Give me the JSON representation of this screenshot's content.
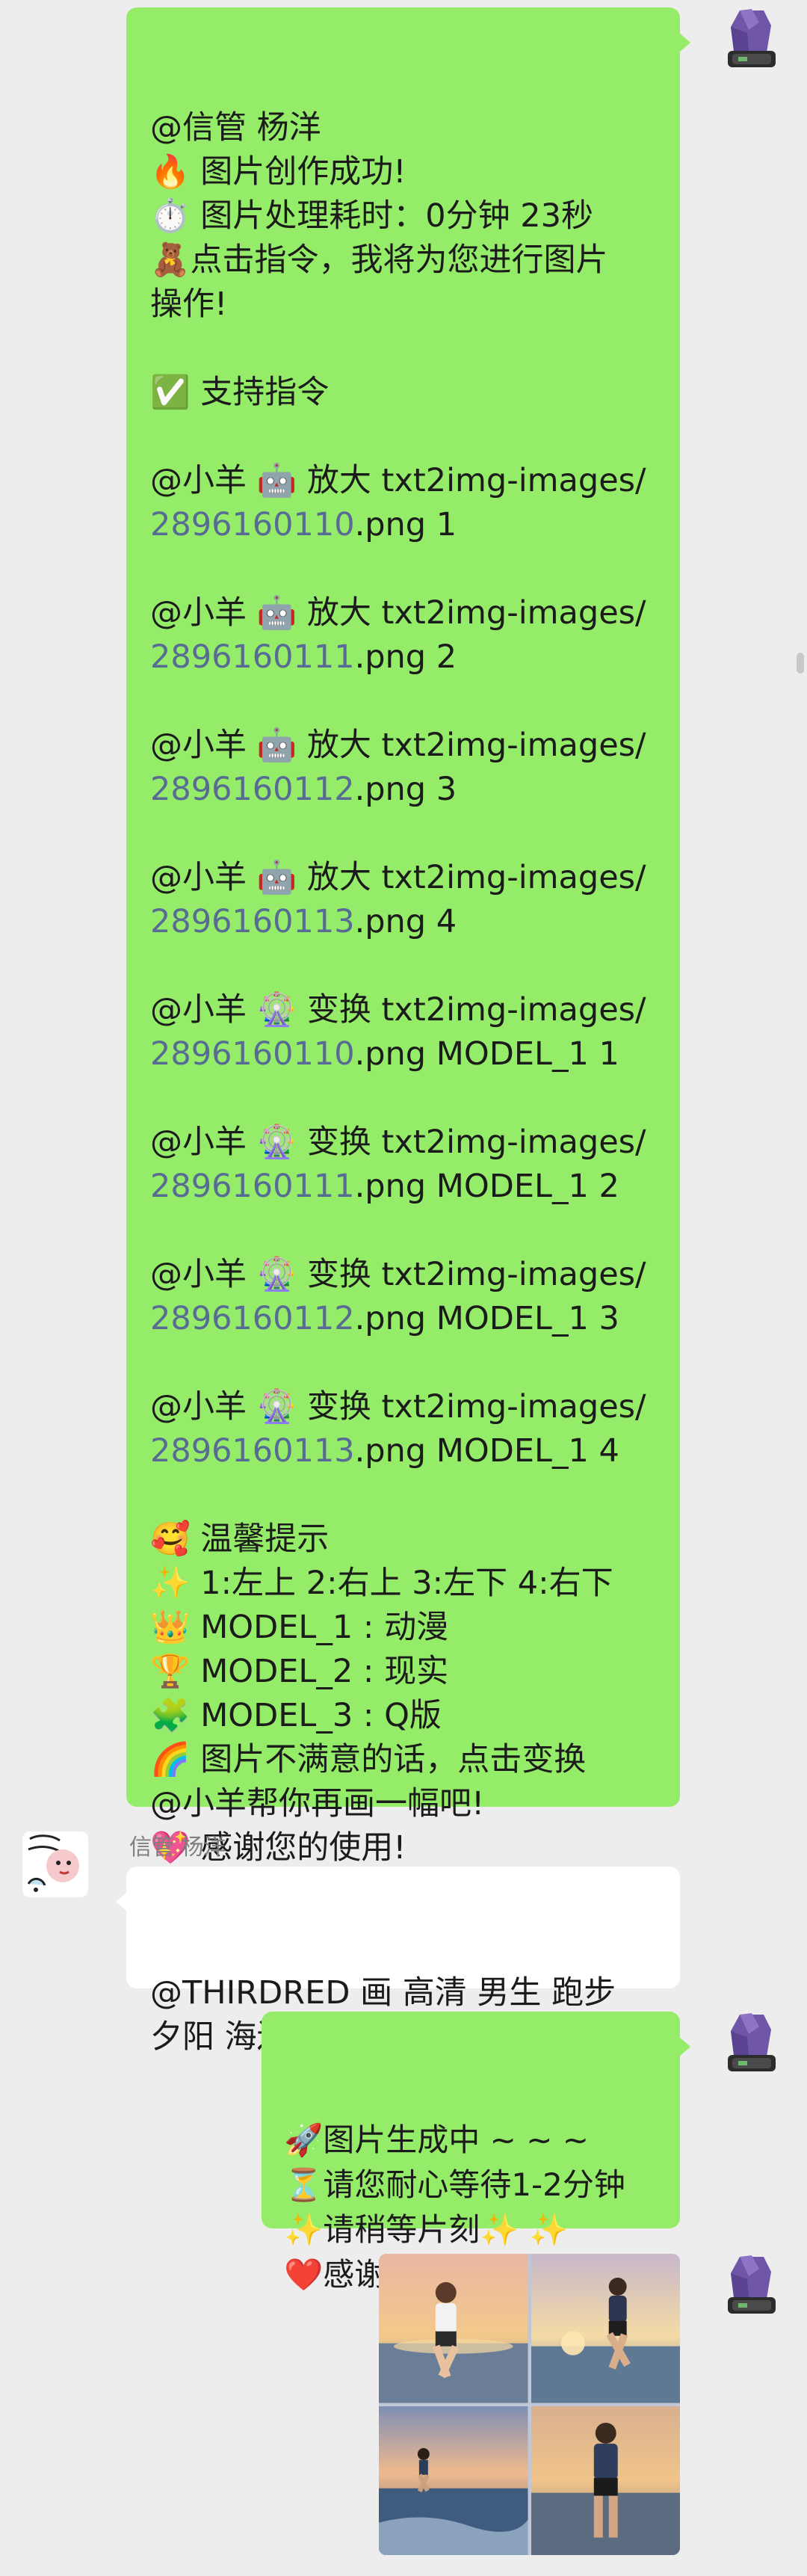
{
  "messages": [
    {
      "side": "right",
      "lines": [
        [
          {
            "t": "@信管 杨洋"
          }
        ],
        [
          {
            "t": "🔥 图片创作成功!"
          }
        ],
        [
          {
            "t": "⏱️ 图片处理耗时：0分钟 23秒"
          }
        ],
        [
          {
            "t": "🧸点击指令，我将为您进行图片"
          }
        ],
        [
          {
            "t": "操作!"
          }
        ],
        [
          {
            "t": ""
          }
        ],
        [
          {
            "t": "✅ 支持指令"
          }
        ],
        [
          {
            "t": ""
          }
        ],
        [
          {
            "t": "@小羊 🤖 放大 txt2img-images/"
          }
        ],
        [
          {
            "t": "2896160110",
            "link": true
          },
          {
            "t": ".png 1"
          }
        ],
        [
          {
            "t": ""
          }
        ],
        [
          {
            "t": "@小羊 🤖 放大 txt2img-images/"
          }
        ],
        [
          {
            "t": "2896160111",
            "link": true
          },
          {
            "t": ".png 2"
          }
        ],
        [
          {
            "t": ""
          }
        ],
        [
          {
            "t": "@小羊 🤖 放大 txt2img-images/"
          }
        ],
        [
          {
            "t": "2896160112",
            "link": true
          },
          {
            "t": ".png 3"
          }
        ],
        [
          {
            "t": ""
          }
        ],
        [
          {
            "t": "@小羊 🤖 放大 txt2img-images/"
          }
        ],
        [
          {
            "t": "2896160113",
            "link": true
          },
          {
            "t": ".png 4"
          }
        ],
        [
          {
            "t": ""
          }
        ],
        [
          {
            "t": "@小羊 🎡 变换 txt2img-images/"
          }
        ],
        [
          {
            "t": "2896160110",
            "link": true
          },
          {
            "t": ".png MODEL_1 1"
          }
        ],
        [
          {
            "t": ""
          }
        ],
        [
          {
            "t": "@小羊 🎡 变换 txt2img-images/"
          }
        ],
        [
          {
            "t": "2896160111",
            "link": true
          },
          {
            "t": ".png MODEL_1 2"
          }
        ],
        [
          {
            "t": ""
          }
        ],
        [
          {
            "t": "@小羊 🎡 变换 txt2img-images/"
          }
        ],
        [
          {
            "t": "2896160112",
            "link": true
          },
          {
            "t": ".png MODEL_1 3"
          }
        ],
        [
          {
            "t": ""
          }
        ],
        [
          {
            "t": "@小羊 🎡 变换 txt2img-images/"
          }
        ],
        [
          {
            "t": "2896160113",
            "link": true
          },
          {
            "t": ".png MODEL_1 4"
          }
        ],
        [
          {
            "t": ""
          }
        ],
        [
          {
            "t": "🥰 温馨提示"
          }
        ],
        [
          {
            "t": "✨ 1:左上 2:右上 3:左下 4:右下"
          }
        ],
        [
          {
            "t": "👑 MODEL_1 : 动漫"
          }
        ],
        [
          {
            "t": "🏆 MODEL_2 : 现实"
          }
        ],
        [
          {
            "t": "🧩 MODEL_3 : Q版"
          }
        ],
        [
          {
            "t": "🌈 图片不满意的话，点击变换"
          }
        ],
        [
          {
            "t": "@小羊帮你再画一幅吧!"
          }
        ],
        [
          {
            "t": "💖 感谢您的使用!"
          }
        ]
      ]
    },
    {
      "side": "left",
      "sender": "信管 杨洋",
      "lines": [
        [
          {
            "t": "@THIRDRED 画 高清 男生 跑步"
          }
        ],
        [
          {
            "t": "夕阳 海边"
          }
        ]
      ]
    },
    {
      "side": "right",
      "lines": [
        [
          {
            "t": "🚀图片生成中 ~ ~ ~"
          }
        ],
        [
          {
            "t": "⏳请您耐心等待1-2分钟"
          }
        ],
        [
          {
            "t": "✨请稍等片刻✨ ✨"
          }
        ],
        [
          {
            "t": "❤️感谢您的耐心与支持"
          }
        ]
      ]
    }
  ],
  "image_message": {
    "side": "right",
    "description_icon": "image-grid"
  },
  "colors": {
    "background": "#ededed",
    "self_bubble": "#95ec69",
    "other_bubble": "#ffffff",
    "link": "#576b95",
    "sender_name": "#7f7f7f"
  }
}
